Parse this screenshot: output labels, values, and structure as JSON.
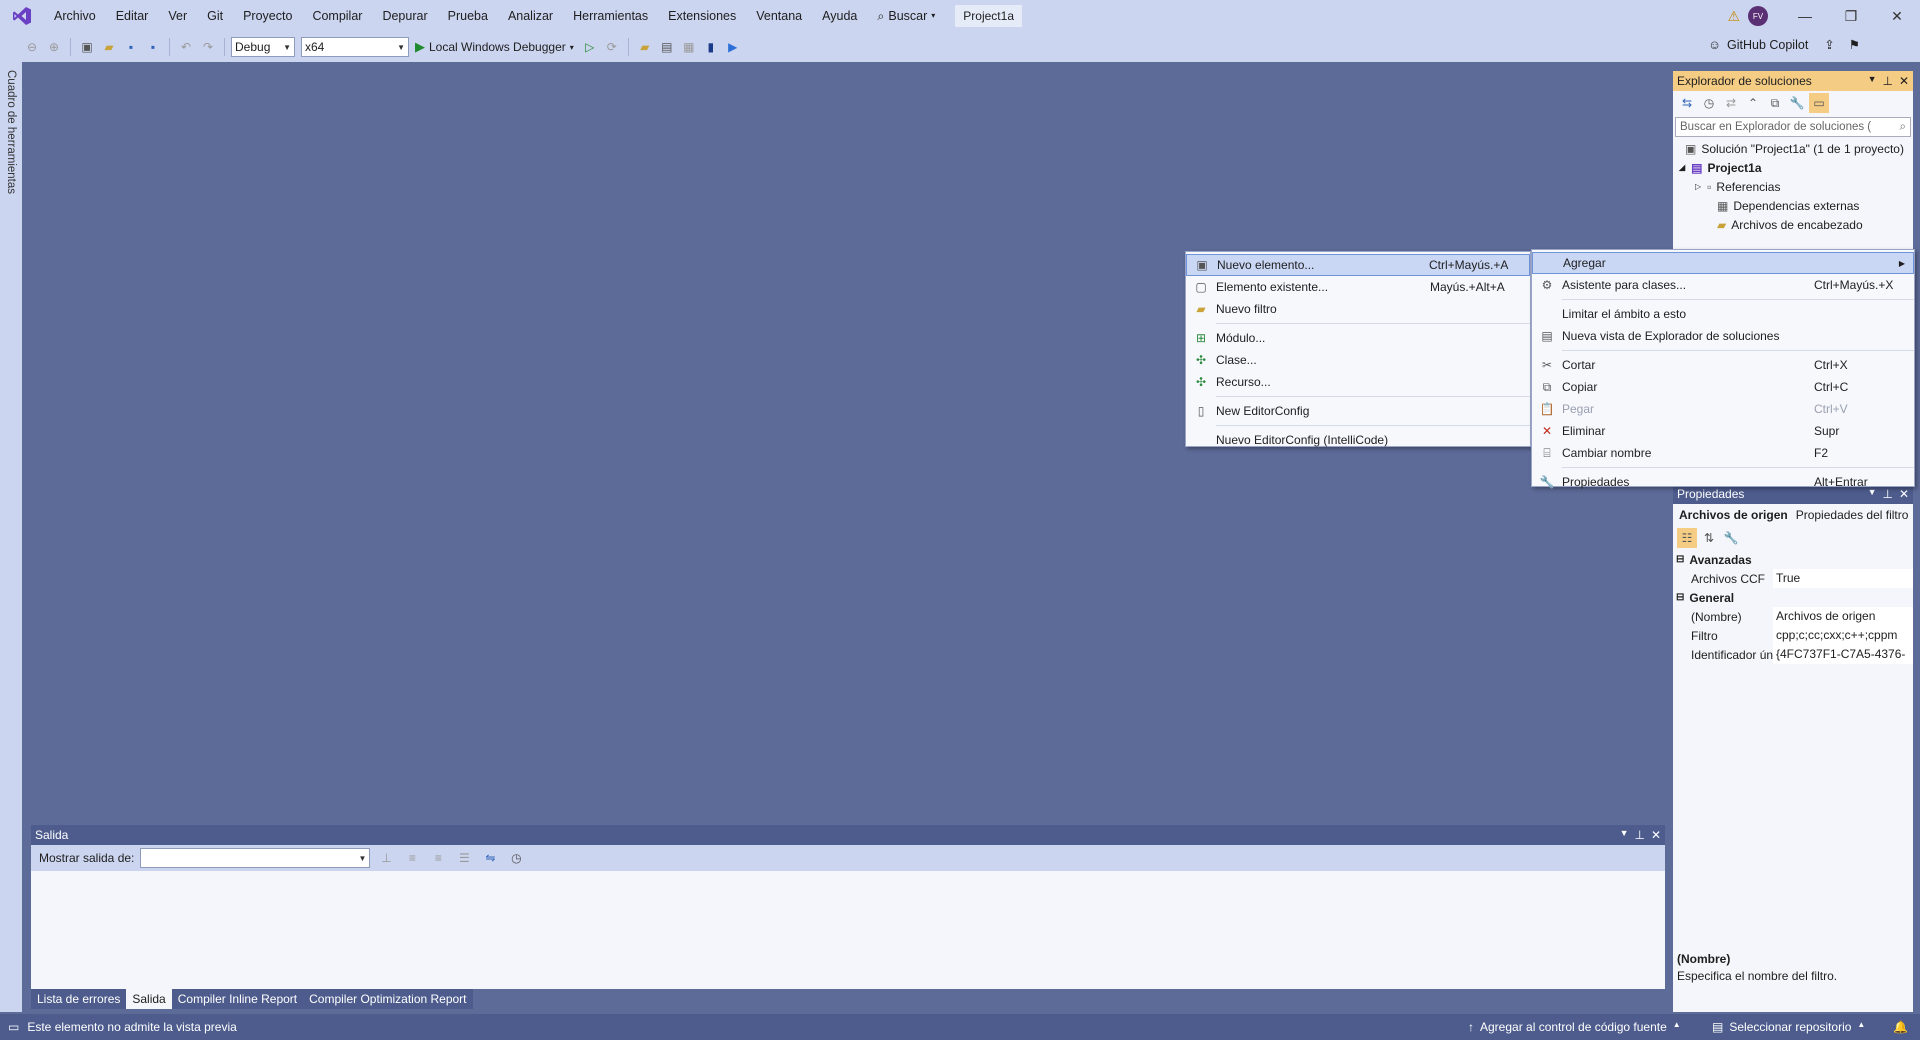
{
  "titlebar": {
    "menu": [
      "Archivo",
      "Editar",
      "Ver",
      "Git",
      "Proyecto",
      "Compilar",
      "Depurar",
      "Prueba",
      "Analizar",
      "Herramientas",
      "Extensiones",
      "Ventana",
      "Ayuda"
    ],
    "search_label": "Buscar",
    "project_name": "Project1a",
    "avatar_initials": "FV"
  },
  "toolbar": {
    "config": "Debug",
    "platform": "x64",
    "run_label": "Local Windows Debugger",
    "copilot_label": "GitHub Copilot"
  },
  "toolbox": {
    "label": "Cuadro de herramientas"
  },
  "solution_explorer": {
    "title": "Explorador de soluciones",
    "search_placeholder": "Buscar en Explorador de soluciones (",
    "items": [
      {
        "label": "Solución \"Project1a\"  (1 de 1 proyecto)",
        "icon": "solution-icon"
      },
      {
        "label": "Project1a",
        "icon": "project-icon"
      },
      {
        "label": "Referencias",
        "icon": "references-icon"
      },
      {
        "label": "Dependencias externas",
        "icon": "external-deps-icon"
      },
      {
        "label": "Archivos de encabezado",
        "icon": "folder-icon"
      }
    ]
  },
  "context_menu": {
    "items": [
      {
        "label": "Agregar",
        "shortcut": "",
        "icon": "",
        "submenu": true
      },
      {
        "label": "Asistente para clases...",
        "shortcut": "Ctrl+Mayús.+X",
        "icon": "class-wizard-icon"
      },
      {
        "label": "Limitar el ámbito a esto",
        "shortcut": "",
        "icon": ""
      },
      {
        "label": "Nueva vista de Explorador de soluciones",
        "shortcut": "",
        "icon": "new-view-icon"
      },
      {
        "label": "Cortar",
        "shortcut": "Ctrl+X",
        "icon": "cut-icon"
      },
      {
        "label": "Copiar",
        "shortcut": "Ctrl+C",
        "icon": "copy-icon"
      },
      {
        "label": "Pegar",
        "shortcut": "Ctrl+V",
        "icon": "paste-icon"
      },
      {
        "label": "Eliminar",
        "shortcut": "Supr",
        "icon": "delete-icon"
      },
      {
        "label": "Cambiar nombre",
        "shortcut": "F2",
        "icon": "rename-icon"
      },
      {
        "label": "Propiedades",
        "shortcut": "Alt+Entrar",
        "icon": "wrench-icon"
      }
    ]
  },
  "submenu": {
    "items": [
      {
        "label": "Nuevo elemento...",
        "shortcut": "Ctrl+Mayús.+A",
        "icon": "new-item-icon"
      },
      {
        "label": "Elemento existente...",
        "shortcut": "Mayús.+Alt+A",
        "icon": "existing-item-icon"
      },
      {
        "label": "Nuevo filtro",
        "shortcut": "",
        "icon": "folder-icon"
      },
      {
        "label": "Módulo...",
        "shortcut": "",
        "icon": "module-icon"
      },
      {
        "label": "Clase...",
        "shortcut": "",
        "icon": "class-icon"
      },
      {
        "label": "Recurso...",
        "shortcut": "",
        "icon": "resource-icon"
      },
      {
        "label": "New EditorConfig",
        "shortcut": "",
        "icon": "editorconfig-icon"
      },
      {
        "label": "Nuevo EditorConfig (IntelliCode)",
        "shortcut": "",
        "icon": ""
      }
    ]
  },
  "properties": {
    "title": "Propiedades",
    "object_name": "Archivos de origen",
    "object_type": "Propiedades del filtro",
    "categories": [
      {
        "name": "Avanzadas",
        "rows": [
          {
            "name": "Archivos CCF",
            "value": "True"
          }
        ]
      },
      {
        "name": "General",
        "rows": [
          {
            "name": "(Nombre)",
            "value": "Archivos de origen"
          },
          {
            "name": "Filtro",
            "value": "cpp;c;cc;cxx;c++;cppm"
          },
          {
            "name": "Identificador único",
            "value": "{4FC737F1-C7A5-4376-"
          }
        ]
      }
    ],
    "desc_title": "(Nombre)",
    "desc_text": "Especifica el nombre del filtro."
  },
  "output": {
    "title": "Salida",
    "show_from_label": "Mostrar salida de:",
    "show_from_value": "",
    "tabs": [
      "Lista de errores",
      "Salida",
      "Compiler Inline Report",
      "Compiler Optimization Report"
    ],
    "active_tab": "Salida"
  },
  "statusbar": {
    "left_text": "Este elemento no admite la vista previa",
    "source_control": "Agregar al control de código fuente",
    "repo": "Seleccionar repositorio"
  },
  "colors": {
    "accent_active_pane": "#f5cc84",
    "background": "#5d6b99",
    "chrome": "#ccd5f0",
    "statusbar": "#4d5c8d"
  }
}
